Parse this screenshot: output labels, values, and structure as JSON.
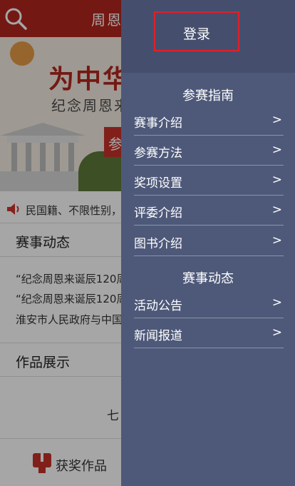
{
  "main": {
    "topbar": {
      "title": "周恩"
    },
    "banner": {
      "headline": "为中华",
      "subtitle": "纪念周恩来",
      "cta": "参"
    },
    "notice": {
      "text": "民国籍、不限性别，坞"
    },
    "section_news": {
      "title": "赛事动态"
    },
    "news": [
      "“纪念周恩来诞辰120周",
      "“纪念周恩来诞辰120周",
      "淮安市人民政府与中国"
    ],
    "section_works": {
      "title": "作品展示"
    },
    "seventh_text": "七",
    "bottom_nav": {
      "award_label": "获奖作品"
    },
    "colors": {
      "brand_red": "#b3261e"
    }
  },
  "drawer": {
    "login_label": "登录",
    "groups": [
      {
        "title": "参赛指南",
        "items": [
          {
            "label": "赛事介绍",
            "chevron": ">"
          },
          {
            "label": "参赛方法",
            "chevron": ">"
          },
          {
            "label": "奖项设置",
            "chevron": ">"
          },
          {
            "label": "评委介绍",
            "chevron": ">"
          },
          {
            "label": "图书介绍",
            "chevron": ">"
          }
        ]
      },
      {
        "title": "赛事动态",
        "items": [
          {
            "label": "活动公告",
            "chevron": ">"
          },
          {
            "label": "新闻报道",
            "chevron": ">"
          }
        ]
      }
    ],
    "colors": {
      "background": "#4e5979",
      "login_border": "#e0202a"
    }
  }
}
